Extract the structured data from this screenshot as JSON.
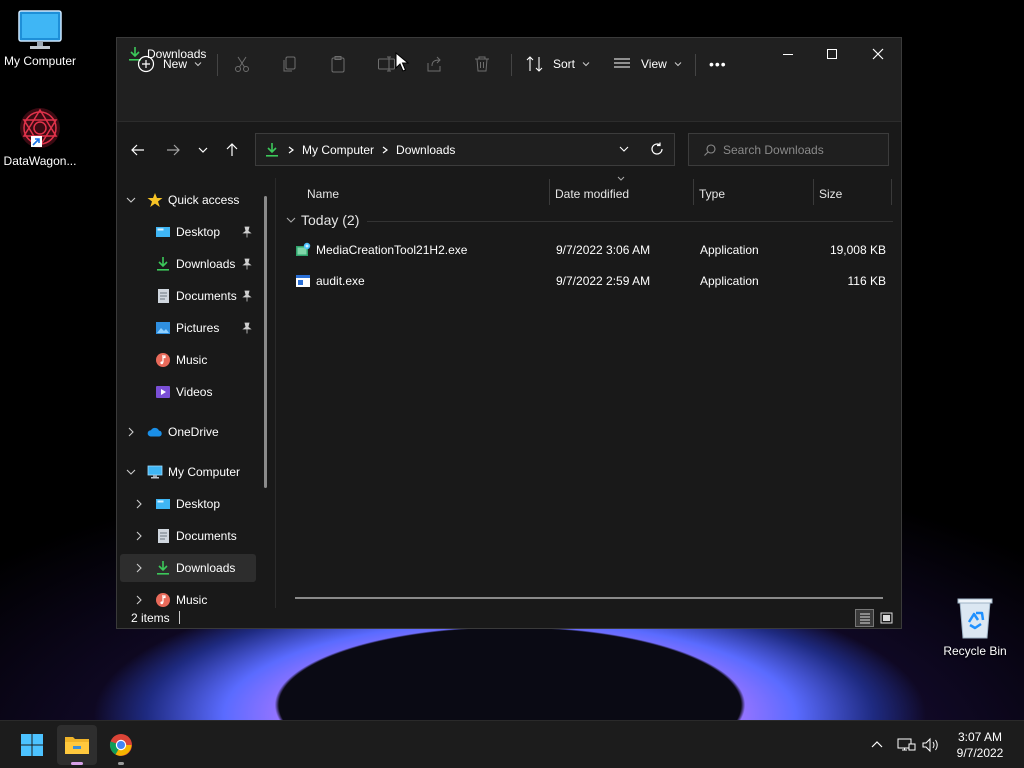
{
  "desktop": {
    "icons": [
      {
        "label": "My Computer"
      },
      {
        "label": "DataWagon..."
      },
      {
        "label": "Recycle Bin"
      }
    ]
  },
  "window": {
    "title": "Downloads",
    "toolbar": {
      "new_label": "New",
      "sort_label": "Sort",
      "view_label": "View",
      "more_label": "•••"
    },
    "address": {
      "crumbs": [
        "My Computer",
        "Downloads"
      ]
    },
    "search": {
      "placeholder": "Search Downloads"
    },
    "sidebar": {
      "quick_access": "Quick access",
      "quick_items": [
        "Desktop",
        "Downloads",
        "Documents",
        "Pictures",
        "Music",
        "Videos"
      ],
      "onedrive": "OneDrive",
      "my_computer": "My Computer",
      "computer_items": [
        "Desktop",
        "Documents",
        "Downloads",
        "Music"
      ]
    },
    "columns": {
      "name": "Name",
      "date": "Date modified",
      "type": "Type",
      "size": "Size"
    },
    "group_label": "Today (2)",
    "files": [
      {
        "name": "MediaCreationTool21H2.exe",
        "date": "9/7/2022 3:06 AM",
        "type": "Application",
        "size": "19,008 KB"
      },
      {
        "name": "audit.exe",
        "date": "9/7/2022 2:59 AM",
        "type": "Application",
        "size": "116 KB"
      }
    ],
    "status": {
      "items": "2 items"
    }
  },
  "taskbar": {
    "time": "3:07 AM",
    "date": "9/7/2022"
  },
  "colors": {
    "accent_green": "#3cc85a",
    "window_bg": "#191919",
    "chrome_bg": "#202020",
    "selection": "#2d2d2d",
    "win_blue": "#4cc2ff"
  }
}
